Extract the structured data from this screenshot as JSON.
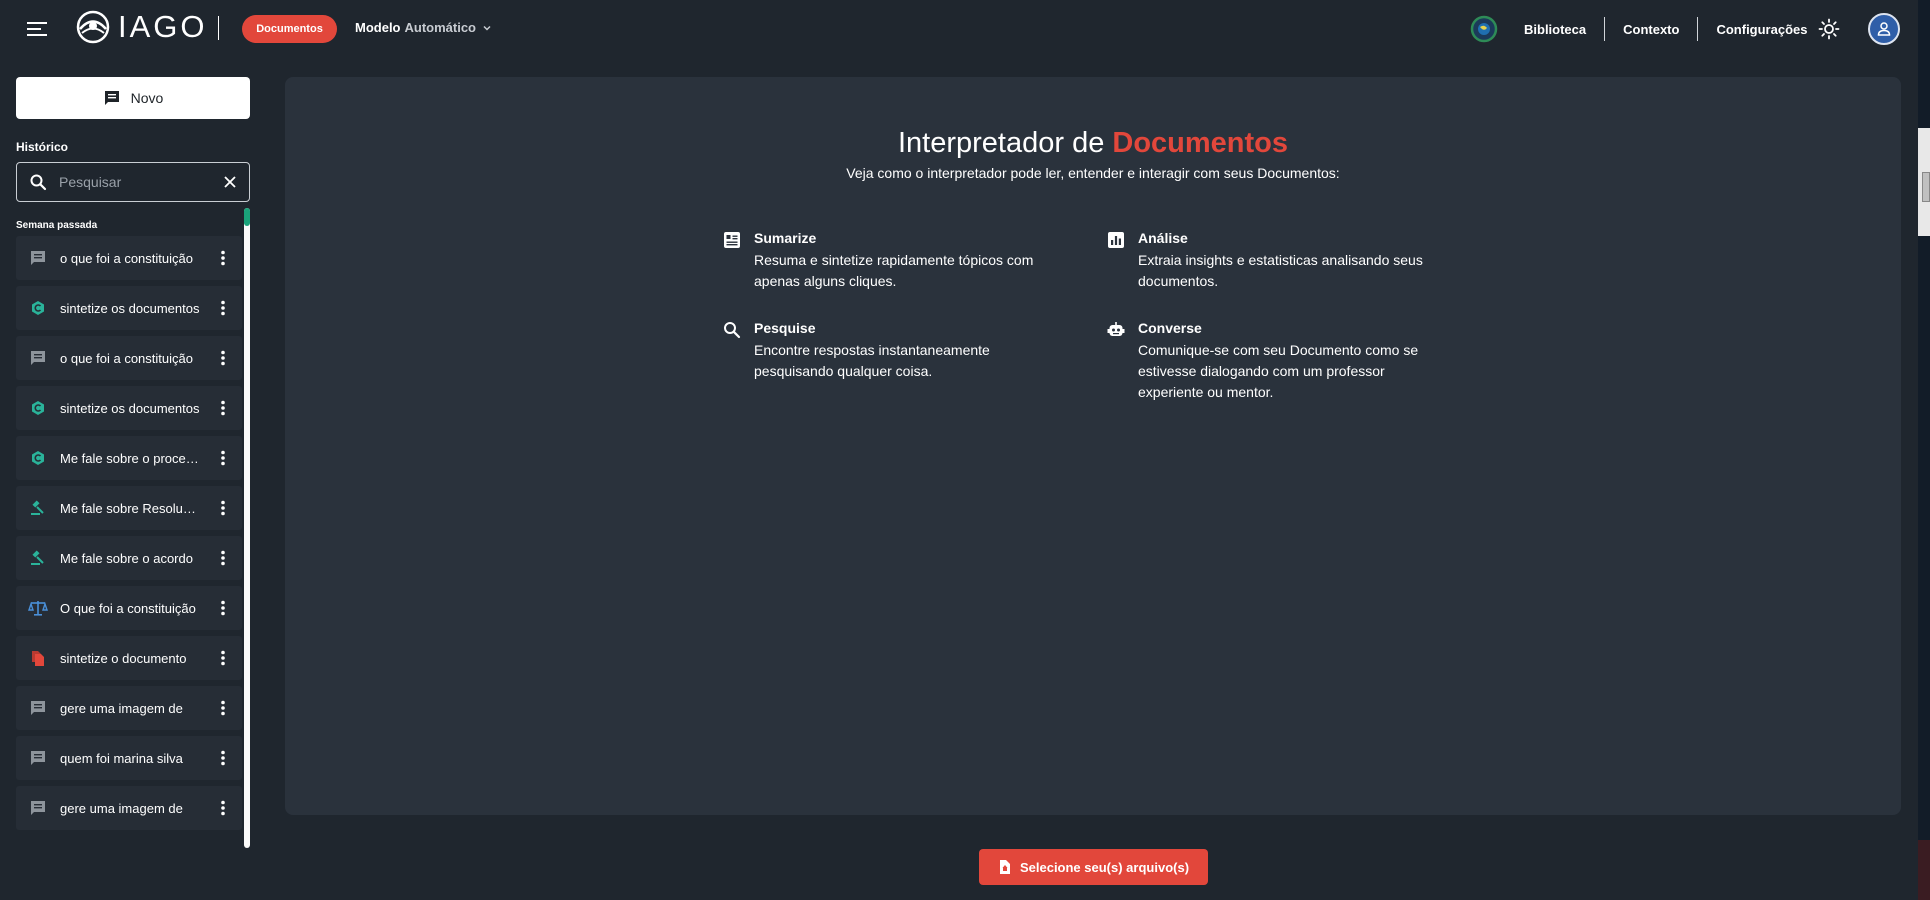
{
  "header": {
    "logo_text": "IAGO",
    "mode_pill": "Documentos",
    "model": {
      "label": "Modelo",
      "value": "Automático"
    },
    "nav": [
      "Biblioteca",
      "Contexto",
      "Configurações"
    ],
    "accent_color": "#e2473b"
  },
  "sidebar": {
    "new_button": "Novo",
    "history_title": "Histórico",
    "search": {
      "placeholder": "Pesquisar",
      "value": ""
    },
    "group_label": "Semana passada",
    "items": [
      {
        "label": "o que foi a constituição",
        "icon": "chat-icon"
      },
      {
        "label": "sintetize os documentos",
        "icon": "gpt-icon"
      },
      {
        "label": "o que foi a constituição",
        "icon": "chat-icon"
      },
      {
        "label": "sintetize os documentos",
        "icon": "gpt-icon"
      },
      {
        "label": "Me fale sobre o processo",
        "icon": "gpt-icon"
      },
      {
        "label": "Me fale sobre Resolução",
        "icon": "gavel-icon"
      },
      {
        "label": "Me fale sobre o acordo",
        "icon": "gavel-icon"
      },
      {
        "label": "O que foi a constituição",
        "icon": "scale-icon"
      },
      {
        "label": "sintetize o documento",
        "icon": "document-icon"
      },
      {
        "label": "gere uma imagem de",
        "icon": "chat-icon"
      },
      {
        "label": "quem foi marina silva",
        "icon": "chat-icon"
      },
      {
        "label": "gere uma imagem de",
        "icon": "chat-icon"
      }
    ]
  },
  "main": {
    "title_prefix": "Interpretador de",
    "title_accent": "Documentos",
    "subtitle": "Veja como o interpretador pode ler, entender e interagir com seus Documentos:",
    "features": [
      {
        "title": "Sumarize",
        "desc": "Resuma e sintetize rapidamente tópicos com apenas alguns cliques.",
        "icon": "summary-icon"
      },
      {
        "title": "Análise",
        "desc": "Extraia insights e estatisticas analisando seus documentos.",
        "icon": "bar-chart-icon"
      },
      {
        "title": "Pesquise",
        "desc": "Encontre respostas instantaneamente pesquisando qualquer coisa.",
        "icon": "search-icon"
      },
      {
        "title": "Converse",
        "desc": "Comunique-se com seu Documento como se estivesse dialogando com um professor experiente ou mentor.",
        "icon": "robot-icon"
      }
    ],
    "select_button": "Selecione seu(s) arquivo(s)"
  }
}
